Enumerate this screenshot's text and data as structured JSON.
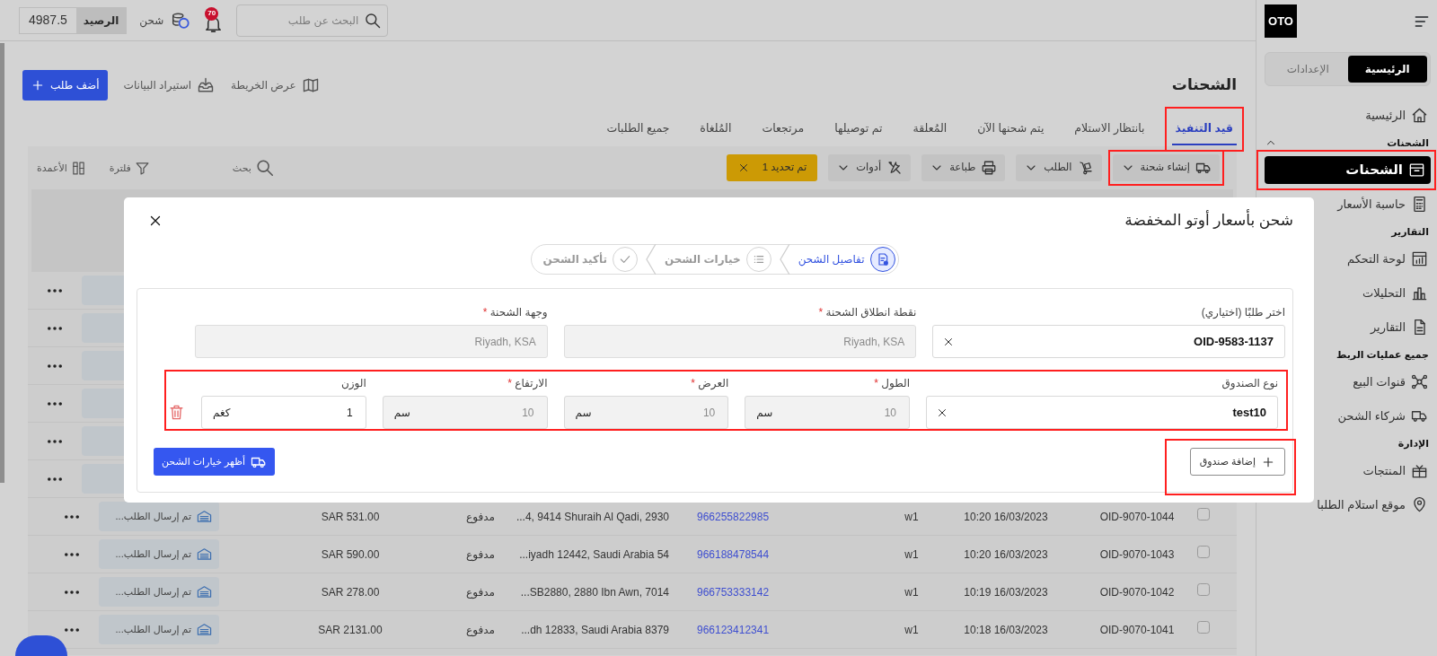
{
  "topbar": {
    "search": {
      "placeholder": "البحث عن طلب"
    },
    "notifications": {
      "count": "70"
    },
    "recharge": {
      "label": "شحن"
    },
    "balance": {
      "label": "الرصيد",
      "value": "4987.5"
    }
  },
  "sidebar": {
    "logo": "OTO",
    "segments": [
      {
        "label": "الرئيسية",
        "selected": true
      },
      {
        "label": "الإعدادات",
        "selected": false
      }
    ],
    "items": [
      {
        "kind": "link",
        "label": "الرئيسية",
        "selected": false,
        "highlighted": false
      },
      {
        "kind": "section",
        "label": "الشحنات",
        "expanded": true
      },
      {
        "kind": "link",
        "label": "الشحنات",
        "selected": true,
        "highlighted": true
      },
      {
        "kind": "link",
        "label": "حاسبة الأسعار",
        "selected": false,
        "highlighted": false
      },
      {
        "kind": "section",
        "label": "التقارير"
      },
      {
        "kind": "link",
        "label": "لوحة التحكم",
        "selected": false,
        "highlighted": false
      },
      {
        "kind": "link",
        "label": "التحليلات",
        "selected": false,
        "highlighted": false
      },
      {
        "kind": "link",
        "label": "التقارير",
        "selected": false,
        "highlighted": false
      },
      {
        "kind": "section",
        "label": "جميع عمليات الربط"
      },
      {
        "kind": "link",
        "label": "قنوات البيع",
        "selected": false,
        "highlighted": false
      },
      {
        "kind": "link",
        "label": "شركاء الشحن",
        "selected": false,
        "highlighted": false
      },
      {
        "kind": "section",
        "label": "الإدارة"
      },
      {
        "kind": "link",
        "label": "المنتجات",
        "selected": false,
        "highlighted": false
      },
      {
        "kind": "link",
        "label": "موقع استلام الطلبا",
        "selected": false,
        "highlighted": false
      }
    ]
  },
  "page": {
    "title": "الشحنات",
    "actions": [
      {
        "kind": "link",
        "label": "عرض الخريطة"
      },
      {
        "kind": "link",
        "label": "استيراد البيانات"
      },
      {
        "kind": "primary",
        "label": "أضف طلب"
      }
    ]
  },
  "tabs": [
    {
      "label": "قيد التنفيذ",
      "selected": true,
      "highlighted": true
    },
    {
      "label": "بانتظار الاستلام",
      "selected": false,
      "highlighted": false
    },
    {
      "label": "يتم شحنها الآن",
      "selected": false,
      "highlighted": false
    },
    {
      "label": "المُعلقة",
      "selected": false,
      "highlighted": false
    },
    {
      "label": "تم توصيلها",
      "selected": false,
      "highlighted": false
    },
    {
      "label": "مرتجعات",
      "selected": false,
      "highlighted": false
    },
    {
      "label": "المُلغاة",
      "selected": false,
      "highlighted": false
    },
    {
      "label": "جميع الطلبات",
      "selected": false,
      "highlighted": false
    }
  ],
  "toolbar": {
    "buttons": [
      {
        "label": "إنشاء شحنة",
        "highlighted": true
      },
      {
        "label": "الطلب",
        "highlighted": false
      },
      {
        "label": "طباعة",
        "highlighted": false
      },
      {
        "label": "أدوات",
        "highlighted": false
      }
    ],
    "selection": {
      "label": "تم تحديد 1"
    },
    "tools": [
      {
        "label": "بحث"
      },
      {
        "label": "فلترة"
      },
      {
        "label": "الأعمدة"
      }
    ]
  },
  "table": {
    "rows": [
      {
        "covered": true
      },
      {
        "covered": true
      },
      {
        "covered": true
      },
      {
        "covered": true
      },
      {
        "covered": true
      },
      {
        "covered": true
      },
      {
        "covered": false,
        "checked": false,
        "column_1": "OID-9070-1044",
        "column_2": "10:20 16/03/2023",
        "column_3": "w1",
        "column_4": "966255822985",
        "column_5": "...4, 9414 Shuraih Al Qadi, 2930",
        "column_6": "مدفوع",
        "column_7": "SAR 531.00",
        "column_8": "تم إرسال الطلب..."
      },
      {
        "covered": false,
        "checked": false,
        "column_1": "OID-9070-1043",
        "column_2": "10:20 16/03/2023",
        "column_3": "w1",
        "column_4": "966188478544",
        "column_5": "...iyadh 12442, Saudi Arabia 54",
        "column_6": "مدفوع",
        "column_7": "SAR 590.00",
        "column_8": "تم إرسال الطلب..."
      },
      {
        "covered": false,
        "checked": false,
        "column_1": "OID-9070-1042",
        "column_2": "10:19 16/03/2023",
        "column_3": "w1",
        "column_4": "966753333142",
        "column_5": "...SB2880, 2880 Ibn Awn, 7014",
        "column_6": "مدفوع",
        "column_7": "SAR 278.00",
        "column_8": "تم إرسال الطلب..."
      },
      {
        "covered": false,
        "checked": false,
        "column_1": "OID-9070-1041",
        "column_2": "10:18 16/03/2023",
        "column_3": "w1",
        "column_4": "966123412341",
        "column_5": "...dh 12833, Saudi Arabia 8379",
        "column_6": "مدفوع",
        "column_7": "SAR 2131.00",
        "column_8": "تم إرسال الطلب..."
      }
    ]
  },
  "modal": {
    "title": "شحن بأسعار أوتو المخفضة",
    "steps": [
      {
        "label": "تفاصيل الشحن",
        "selected": true
      },
      {
        "label": "خيارات الشحن",
        "selected": false
      },
      {
        "label": "تأكيد الشحن",
        "selected": false
      }
    ],
    "fields": [
      {
        "kind": "select",
        "label": "اختر طلبًا (اختياري)",
        "value": "OID-9583-1137",
        "disabled": false
      },
      {
        "kind": "text",
        "label": "نقطة انطلاق الشحنة",
        "mark": "*",
        "value": "Riyadh, KSA",
        "disabled": true
      },
      {
        "kind": "text",
        "label": "وجهة الشحنة",
        "mark": "*",
        "value": "Riyadh, KSA",
        "disabled": true
      }
    ],
    "box": {
      "highlighted": true,
      "fields": [
        {
          "kind": "select",
          "label": "نوع الصندوق",
          "value": "test10",
          "disabled": false
        },
        {
          "kind": "unit",
          "label": "الطول",
          "mark": "*",
          "value": "10",
          "unit": "سم",
          "disabled": true
        },
        {
          "kind": "unit",
          "label": "العرض",
          "mark": "*",
          "value": "10",
          "unit": "سم",
          "disabled": true
        },
        {
          "kind": "unit",
          "label": "الارتفاع",
          "mark": "*",
          "value": "10",
          "unit": "سم",
          "disabled": true
        },
        {
          "kind": "unit",
          "label": "الوزن",
          "value": "1",
          "unit": "كغم",
          "disabled": false
        }
      ]
    },
    "add_box": {
      "label": "إضافة صندوق",
      "highlighted": true
    },
    "submit": {
      "label": "أظهر خيارات الشحن"
    }
  }
}
